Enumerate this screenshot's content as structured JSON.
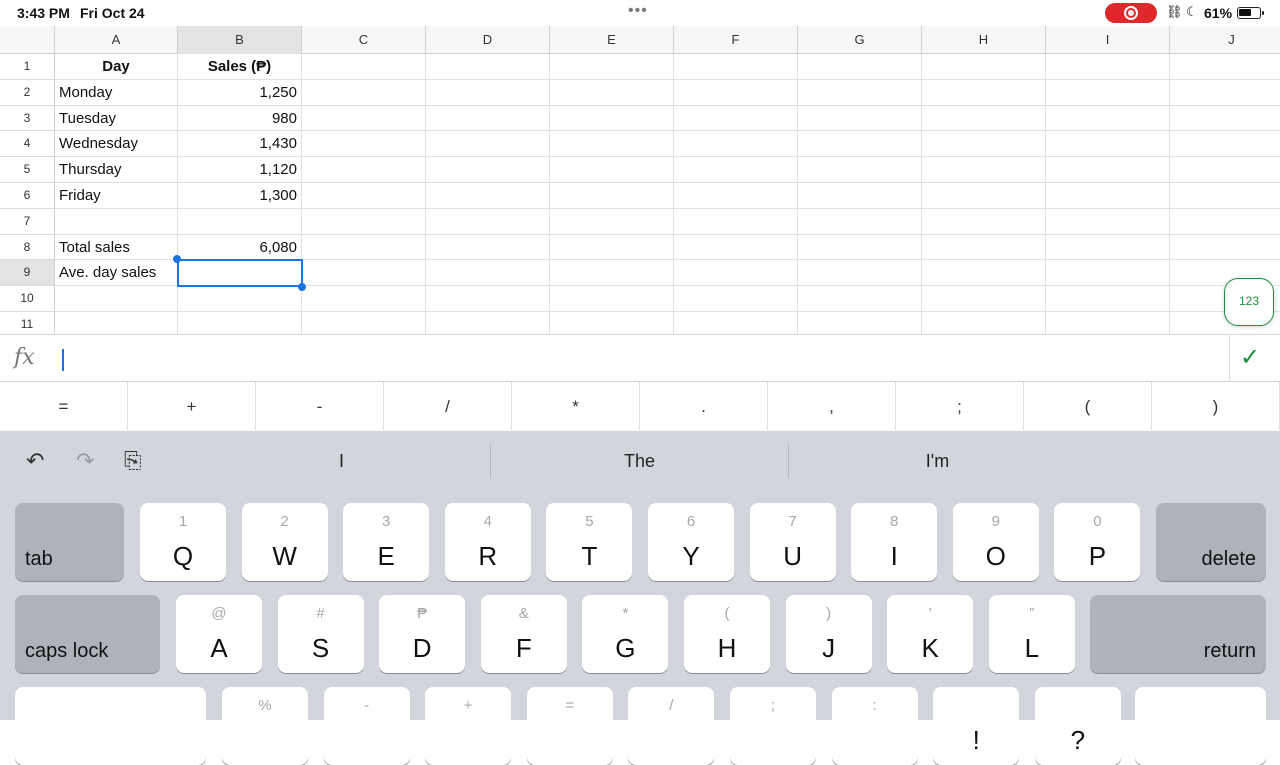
{
  "status_bar": {
    "time": "3:43 PM",
    "date": "Fri Oct 24",
    "more_dots": "•••",
    "battery_pct": "61%",
    "battery_level": 0.61
  },
  "sheet": {
    "columns": [
      "A",
      "B",
      "C",
      "D",
      "E",
      "F",
      "G",
      "H",
      "I",
      "J"
    ],
    "rows": [
      "1",
      "2",
      "3",
      "4",
      "5",
      "6",
      "7",
      "8",
      "9",
      "10",
      "11"
    ],
    "cells": {
      "A1": "Day",
      "B1": "Sales (₱)",
      "A2": "Monday",
      "B2": "1,250",
      "A3": "Tuesday",
      "B3": "980",
      "A4": "Wednesday",
      "B4": "1,430",
      "A5": "Thursday",
      "B5": "1,120",
      "A6": "Friday",
      "B6": "1,300",
      "A8": "Total sales",
      "B8": "6,080",
      "A9": "Ave. day sales",
      "B9": ""
    },
    "selected_cell": "B9",
    "number_button": "123"
  },
  "formula_bar": {
    "fx_label": "fx",
    "value": "",
    "confirm_icon": "✓"
  },
  "operators": [
    "=",
    "+",
    "-",
    "/",
    "*",
    ".",
    ",",
    ";",
    "(",
    ")"
  ],
  "keyboard": {
    "tools": {
      "undo": "↶",
      "redo": "↷",
      "clipboard": "⎘"
    },
    "suggestions": [
      "I",
      "The",
      "I'm"
    ],
    "row1": [
      {
        "sub": "1",
        "main": "Q"
      },
      {
        "sub": "2",
        "main": "W"
      },
      {
        "sub": "3",
        "main": "E"
      },
      {
        "sub": "4",
        "main": "R"
      },
      {
        "sub": "5",
        "main": "T"
      },
      {
        "sub": "6",
        "main": "Y"
      },
      {
        "sub": "7",
        "main": "U"
      },
      {
        "sub": "8",
        "main": "I"
      },
      {
        "sub": "9",
        "main": "O"
      },
      {
        "sub": "0",
        "main": "P"
      }
    ],
    "row2": [
      {
        "sub": "@",
        "main": "A"
      },
      {
        "sub": "#",
        "main": "S"
      },
      {
        "sub": "₱",
        "main": "D"
      },
      {
        "sub": "&",
        "main": "F"
      },
      {
        "sub": "*",
        "main": "G"
      },
      {
        "sub": "(",
        "main": "H"
      },
      {
        "sub": ")",
        "main": "J"
      },
      {
        "sub": "’",
        "main": "K"
      },
      {
        "sub": "”",
        "main": "L"
      }
    ],
    "row3_subs": [
      "%",
      "-",
      "+",
      "=",
      "/",
      ";",
      ":"
    ],
    "row3_main": [
      "",
      "",
      "",
      "",
      "",
      "",
      "",
      "!",
      "?"
    ],
    "tab": "tab",
    "delete": "delete",
    "caps_lock": "caps lock",
    "return": "return"
  }
}
